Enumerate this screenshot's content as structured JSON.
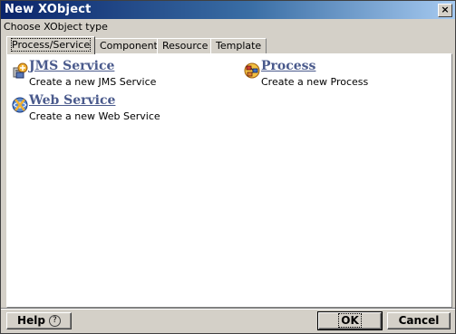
{
  "window": {
    "title": "New XObject",
    "close_glyph": "×"
  },
  "subtitle": "Choose XObject type",
  "tabs": [
    {
      "label": "Process/Service",
      "active": true
    },
    {
      "label": "Component",
      "active": false
    },
    {
      "label": "Resource",
      "active": false
    },
    {
      "label": "Template",
      "active": false
    }
  ],
  "items": [
    {
      "title": "JMS Service",
      "description": "Create a new JMS Service",
      "icon": "jms-service-icon"
    },
    {
      "title": "Process",
      "description": "Create a new Process",
      "icon": "process-icon"
    },
    {
      "title": "Web Service",
      "description": "Create a new Web Service",
      "icon": "web-service-icon"
    }
  ],
  "buttons": {
    "help": "Help",
    "help_icon": "?",
    "ok": "OK",
    "cancel": "Cancel"
  },
  "colors": {
    "link": "#4a5a8c",
    "titlebar_start": "#0a246a",
    "titlebar_end": "#a6caf0",
    "chrome": "#d4d0c8"
  }
}
